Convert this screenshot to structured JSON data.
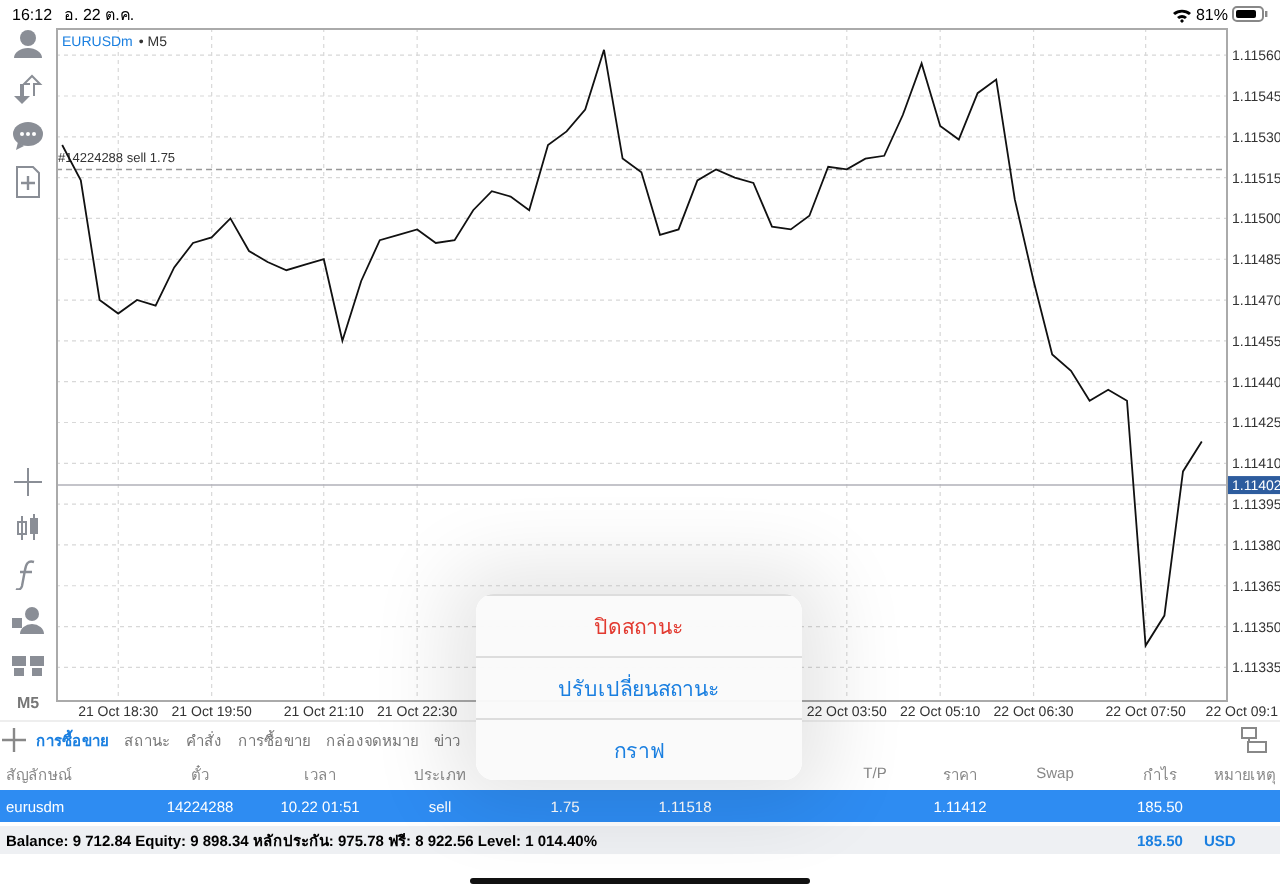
{
  "status_bar": {
    "time": "16:12",
    "date": "อ. 22 ต.ค.",
    "battery": "81%"
  },
  "chart": {
    "symbol": "EURUSDm",
    "period": "• M5",
    "timeframe_button": "M5",
    "chart_data": {
      "type": "line",
      "categories": [
        null,
        null,
        null,
        "21 Oct 18:30",
        null,
        null,
        null,
        null,
        "21 Oct 19:50",
        null,
        null,
        null,
        null,
        null,
        "21 Oct 21:10",
        null,
        null,
        null,
        null,
        "21 Oct 22:30",
        null,
        null,
        null,
        null,
        null,
        null,
        null,
        null,
        null,
        null,
        null,
        null,
        null,
        null,
        null,
        null,
        null,
        null,
        null,
        null,
        null,
        null,
        "22 Oct 03:50",
        null,
        null,
        null,
        null,
        "22 Oct 05:10",
        null,
        null,
        null,
        null,
        "22 Oct 06:30",
        null,
        null,
        null,
        null,
        null,
        "22 Oct 07:50",
        null,
        null,
        null,
        null,
        "22 Oct 09:1"
      ],
      "series": [
        {
          "color": "#111111",
          "values": [
            1.11527,
            1.11514,
            1.1147,
            1.11465,
            1.1147,
            1.11468,
            1.11482,
            1.11491,
            1.11493,
            1.115,
            1.11488,
            1.11484,
            1.11481,
            1.11483,
            1.11485,
            1.11455,
            1.11477,
            1.11492,
            1.11494,
            1.11496,
            1.11491,
            1.11492,
            1.11503,
            1.1151,
            1.11508,
            1.11503,
            1.11527,
            1.11532,
            1.1154,
            1.11562,
            1.11522,
            1.11517,
            1.11494,
            1.11496,
            1.11514,
            1.11518,
            1.11515,
            1.11513,
            1.11497,
            1.11496,
            1.11501,
            1.11519,
            1.11518,
            1.11522,
            1.11523,
            1.11538,
            1.11557,
            1.11534,
            1.11529,
            1.11546,
            1.11551,
            1.11507,
            1.11477,
            1.1145,
            1.11444,
            1.11433,
            1.11437,
            1.11433,
            1.11343,
            1.11354,
            1.11407,
            1.11418,
            null,
            null
          ]
        }
      ],
      "ylim": [
        1.11323,
        1.1157
      ],
      "grid": true,
      "yticks": [
        {
          "value": 1.1156,
          "label": "1.11560"
        },
        {
          "value": 1.11545,
          "label": "1.11545"
        },
        {
          "value": 1.1153,
          "label": "1.11530"
        },
        {
          "value": 1.11515,
          "label": "1.11515"
        },
        {
          "value": 1.115,
          "label": "1.11500"
        },
        {
          "value": 1.11485,
          "label": "1.11485"
        },
        {
          "value": 1.1147,
          "label": "1.11470"
        },
        {
          "value": 1.11455,
          "label": "1.11455"
        },
        {
          "value": 1.1144,
          "label": "1.11440"
        },
        {
          "value": 1.11425,
          "label": "1.11425"
        },
        {
          "value": 1.1141,
          "label": "1.11410"
        },
        {
          "value": 1.11395,
          "label": "1.11395"
        },
        {
          "value": 1.1138,
          "label": "1.11380"
        },
        {
          "value": 1.11365,
          "label": "1.11365"
        },
        {
          "value": 1.1135,
          "label": "1.11350"
        },
        {
          "value": 1.11335,
          "label": "1.11335"
        }
      ],
      "ref_lines": [
        {
          "axis": "y",
          "value": 1.11518,
          "label": "#14224288 sell 1.75"
        },
        {
          "axis": "y",
          "value": 1.11402,
          "label": "1.11402"
        }
      ]
    }
  },
  "tabs": [
    {
      "label": "การซื้อขาย",
      "selected": true
    },
    {
      "label": "สถานะ",
      "selected": false
    },
    {
      "label": "คำสั่ง",
      "selected": false
    },
    {
      "label": "การซื้อขาย",
      "selected": false
    },
    {
      "label": "กล่องจดหมาย",
      "selected": false
    },
    {
      "label": "ข่าว",
      "selected": false
    }
  ],
  "table": {
    "columns": {
      "symbol": "สัญลักษณ์",
      "ticket": "ตั๋ว",
      "time": "เวลา",
      "type": "ประเภท",
      "tp": "T/P",
      "price_current": "ราคา",
      "swap": "Swap",
      "profit": "กำไร",
      "comment": "หมายเหตุ"
    },
    "rows": [
      {
        "symbol": "eurusdm",
        "ticket": "14224288",
        "time": "10.22 01:51",
        "type": "sell",
        "volume": "1.75",
        "price_open": "1.11518",
        "price_current": "1.11412",
        "profit": "185.50",
        "selected": true
      }
    ]
  },
  "balance": {
    "summary": "Balance: 9 712.84 Equity: 9 898.34 หลักประกัน: 975.78 ฟรี: 8 922.56 Level: 1 014.40%",
    "profit": "185.50",
    "currency": "USD"
  },
  "action_sheet": [
    {
      "label": "ปิดสถานะ",
      "kind": "destructive"
    },
    {
      "label": "ปรับเปลี่ยนสถานะ",
      "kind": "default"
    },
    {
      "label": "กราฟ",
      "kind": "default"
    }
  ]
}
